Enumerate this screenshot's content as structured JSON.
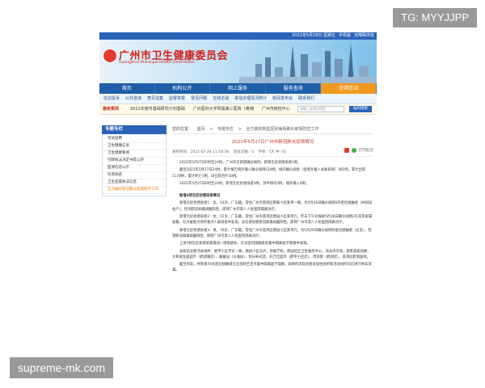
{
  "watermarks": {
    "top_right": "TG: MYYJJPP",
    "bottom_left": "supreme-mk.com"
  },
  "topbar": {
    "date": "2021年5月28日 星期五",
    "links": [
      "手机版",
      "无障碍浏览"
    ]
  },
  "header": {
    "title": "广州市卫生健康委员会",
    "subtitle": "Guangzhou Municipal Health Commission"
  },
  "main_nav": [
    {
      "label": "首页",
      "active": false
    },
    {
      "label": "机构公开",
      "active": false
    },
    {
      "label": "网上服务",
      "active": false
    },
    {
      "label": "服务查询",
      "active": false
    },
    {
      "label": "咨询互动",
      "active": true
    }
  ],
  "sub_nav": [
    "信访投诉",
    "公共咨询",
    "意见征集",
    "监督举报",
    "常见问题",
    "在线访谈",
    "来信办理情况统计",
    "新闻发布会",
    "联系我们"
  ],
  "news_bar": {
    "label": "最新要闻",
    "items": [
      "2022年度市基础研究计划基础",
      "广州医科大学附属第三医院（黄埔",
      "广州市疾控中心"
    ],
    "search_placeholder": "请输入关键字搜索",
    "search_button": "站内搜索"
  },
  "sidebar": {
    "title": "专题专栏",
    "items": [
      {
        "label": "考试招聘",
        "selected": false
      },
      {
        "label": "卫生健康信息",
        "selected": false
      },
      {
        "label": "卫生健康要闻",
        "selected": false
      },
      {
        "label": "行政执法决定书等公开",
        "selected": false
      },
      {
        "label": "医保信息公示",
        "selected": false
      },
      {
        "label": "扫黑除恶",
        "selected": false
      },
      {
        "label": "卫生监督执法信息",
        "selected": false
      },
      {
        "label": "全力做好新冠肺炎疫情防控工作",
        "selected": true
      }
    ]
  },
  "breadcrumb": {
    "prefix": "您的位置：",
    "items": [
      "首页",
      "专题专栏",
      "全力做好新型冠状病毒肺炎疫情防控工作"
    ]
  },
  "article": {
    "title": "2021年5月27日广州市新冠肺炎疫情情况",
    "meta": {
      "publish_time": "发布时间：2021-05-28 11:16:56",
      "views": "浏览次数：0",
      "font": "字体：【大 中 小】"
    },
    "share_label": "打印此页",
    "paragraphs": [
      {
        "text": "2021年5月27日0时至24时，广州市无新增确诊病例，新增无症状感染者1例。",
        "bold": false
      },
      {
        "text": "截至2021年5月27日24时，累计报告境外输入确诊病例529例，境内确诊病例（含境外输入关联病例）381例，累计出院1178例，累计死亡1例，尚在院治疗30例。",
        "bold": false
      },
      {
        "text": "2021年5月27日0时至24时，新增无症状感染者3例，其中境内3例，境外输入0例。",
        "bold": false
      },
      {
        "text": "新增4例无症状感染者情况",
        "bold": true
      },
      {
        "text": "新增无症状感染者1：女，14岁，广东籍，常住广州市荔湾区鹤翠小区某单一楼，为5月26日确诊病例1的密切接触者（共同居住户），检测新冠病毒核酸阳性，即转广州市第八人民医院隔离治疗。",
        "bold": false
      },
      {
        "text": "新增无症状感染者2：女，55岁，广东籍，常住广州市荔湾区鹤园小区某单元，昨天下午对探视5月26日确诊病例2在其及家属就餐，在开展重点场所重点人群排查中发现，该名感染者新冠病毒核酸阳性，即转广州市第八人民医院隔离治疗。",
        "bold": false
      },
      {
        "text": "新增无症状感染者3：男，76岁，广东籍，常住广州市荔湾区鹤园小区某单元，为5月26日确诊病例的密切接触者（丈夫），检测新冠病毒核酸阳性，即转广州市第八人民医院隔离治疗。",
        "bold": false
      },
      {
        "text": "上述3例无症状感染者属同一感染链条，在对密切接触者的集中隔离医学观察中发现。",
        "bold": false
      },
      {
        "text": "发病前主要活动场所：鹤平小区平东一巷，鹤园小区东片，新联学校，鹤园社区卫生服务中心，海龙湾市场，荔景酒家酒楼，大和家生超超市（鹤洞路店），嘉嘉园（沙涌站），恒兴寿司店，好万佳超市（鹤平小区店），贵宾粥（鹤洞店），荔湾区鹤洞医院。",
        "bold": false
      },
      {
        "text": "截至目前，共筛查76名密切接触者已全部转至定点集中隔离医学观察，病例所涉及的相关居住场所和活动场所均已进行终末消毒。",
        "bold": false
      }
    ]
  }
}
